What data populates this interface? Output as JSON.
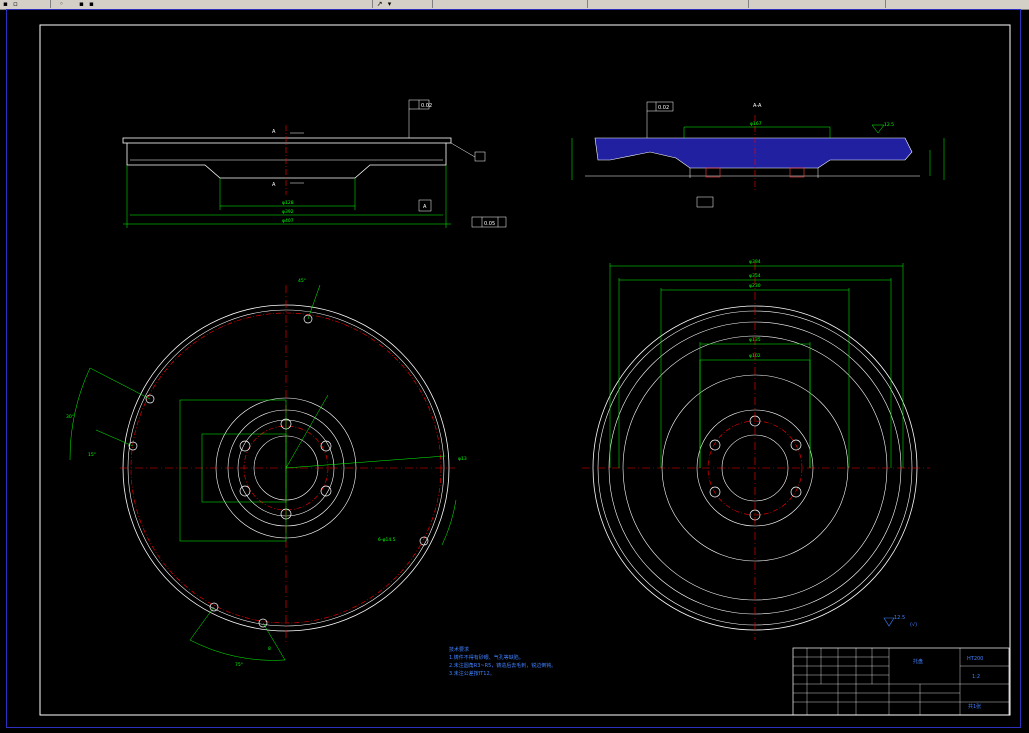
{
  "toolbar": {
    "icons": [
      "file-icon",
      "arrow-icon",
      "layer-icon",
      "pointer-icon",
      "dropdown-icon"
    ]
  },
  "drawing": {
    "front_view": {
      "datum_A": "A",
      "gdt_flatness": "0.02",
      "gdt_position": "0.05",
      "dims": [
        "φ128",
        "φ392",
        "φ407"
      ]
    },
    "section_view": {
      "label": "A-A",
      "gdt_parallel": "0.02",
      "dims": [
        "φ167",
        "12.5"
      ]
    },
    "plan_left": {
      "dims": [
        "45°",
        "30°",
        "15°",
        "75°",
        "8",
        "φ13",
        "6-φ14.5"
      ]
    },
    "plan_right": {
      "dims": [
        "φ394",
        "φ354",
        "φ230",
        "φ135",
        "φ102"
      ]
    },
    "surface_roughness": "12.5",
    "tech_notes": {
      "title": "技术要求",
      "lines": [
        "1.铸件不得有砂眼、气孔等缺陷。",
        "2.未注圆角R3~R5，铸造后去毛刺，锐边倒钝。",
        "3.未注公差按IT12。"
      ]
    },
    "title_block": {
      "part_name": "托盘",
      "drawing_no": "HT200",
      "scale": "1:2",
      "sheet": "共1张"
    }
  }
}
